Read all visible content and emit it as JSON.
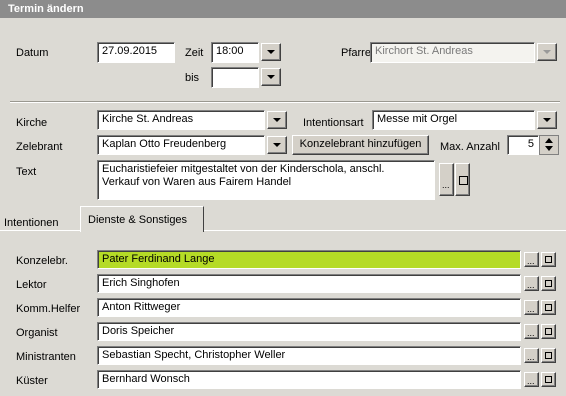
{
  "title": "Termin ändern",
  "top": {
    "datum_label": "Datum",
    "datum_value": "27.09.2015",
    "zeit_label": "Zeit",
    "zeit_value": "18:00",
    "bis_label": "bis",
    "bis_value": "",
    "pfarrei_label": "Pfarrei",
    "pfarrei_value": "Kirchort St. Andreas"
  },
  "mid": {
    "kirche_label": "Kirche",
    "kirche_value": "Kirche St. Andreas",
    "intentionsart_label": "Intentionsart",
    "intentionsart_value": "Messe mit Orgel",
    "zelebrant_label": "Zelebrant",
    "zelebrant_value": "Kaplan Otto Freudenberg",
    "konzelebrant_button": "Konzelebrant hinzufügen",
    "max_label": "Max. Anzahl",
    "max_value": "5",
    "text_label": "Text",
    "text_line1": "Eucharistiefeier mitgestaltet von der Kinderschola, anschl.",
    "text_line2": "Verkauf von Waren aus Fairem Handel"
  },
  "tabs": [
    "Intentionen",
    "Dienste & Sonstiges"
  ],
  "services": [
    {
      "label": "Konzelebr.",
      "value": "Pater Ferdinand Lange"
    },
    {
      "label": "Lektor",
      "value": "Erich Singhofen"
    },
    {
      "label": "Komm.Helfer",
      "value": "Anton Rittweger"
    },
    {
      "label": "Organist",
      "value": "Doris Speicher"
    },
    {
      "label": "Ministranten",
      "value": "Sebastian Specht, Christopher Weller"
    },
    {
      "label": "Küster",
      "value": "Bernhard Wonsch"
    }
  ],
  "colors": {
    "highlight": "#b5db26",
    "titlebar": "#8c8c8c"
  },
  "icons": {
    "ellipsis": "...",
    "dropdown": "chevron-down-icon"
  }
}
